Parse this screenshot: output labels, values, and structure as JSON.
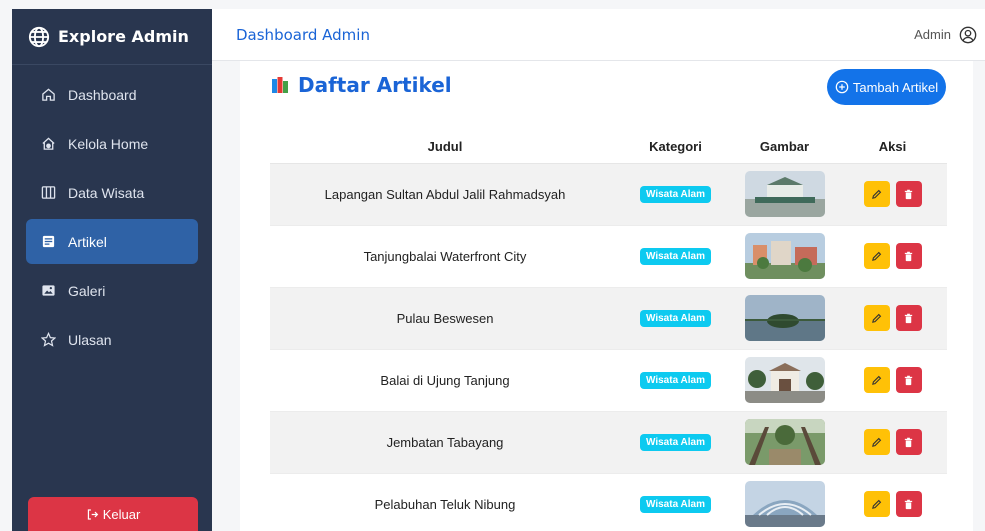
{
  "sidebar": {
    "brand": "Explore Admin",
    "items": [
      {
        "label": "Dashboard",
        "icon": "home-icon",
        "active": false
      },
      {
        "label": "Kelola Home",
        "icon": "house-gear-icon",
        "active": false
      },
      {
        "label": "Data Wisata",
        "icon": "columns-icon",
        "active": false
      },
      {
        "label": "Artikel",
        "icon": "article-icon",
        "active": true
      },
      {
        "label": "Galeri",
        "icon": "gallery-icon",
        "active": false
      },
      {
        "label": "Ulasan",
        "icon": "star-icon",
        "active": false
      }
    ],
    "logout_label": "Keluar"
  },
  "topbar": {
    "title": "Dashboard Admin",
    "user": "Admin"
  },
  "main": {
    "title": "Daftar Artikel",
    "add_label": "Tambah Artikel",
    "columns": [
      "Judul",
      "Kategori",
      "Gambar",
      "Aksi"
    ],
    "rows": [
      {
        "judul": "Lapangan Sultan Abdul Jalil Rahmadsyah",
        "kategori": "Wisata Alam"
      },
      {
        "judul": "Tanjungbalai Waterfront City",
        "kategori": "Wisata Alam"
      },
      {
        "judul": "Pulau Beswesen",
        "kategori": "Wisata Alam"
      },
      {
        "judul": "Balai di Ujung Tanjung",
        "kategori": "Wisata Alam"
      },
      {
        "judul": "Jembatan Tabayang",
        "kategori": "Wisata Alam"
      },
      {
        "judul": "Pelabuhan Teluk Nibung",
        "kategori": "Wisata Alam"
      }
    ]
  },
  "colors": {
    "sidebar_bg": "#29364f",
    "active_item": "#2f62a6",
    "primary": "#1373e9",
    "danger": "#dc3545",
    "warning": "#ffc107",
    "info_badge": "#0dcaf0",
    "title_blue": "#1a64d6"
  }
}
